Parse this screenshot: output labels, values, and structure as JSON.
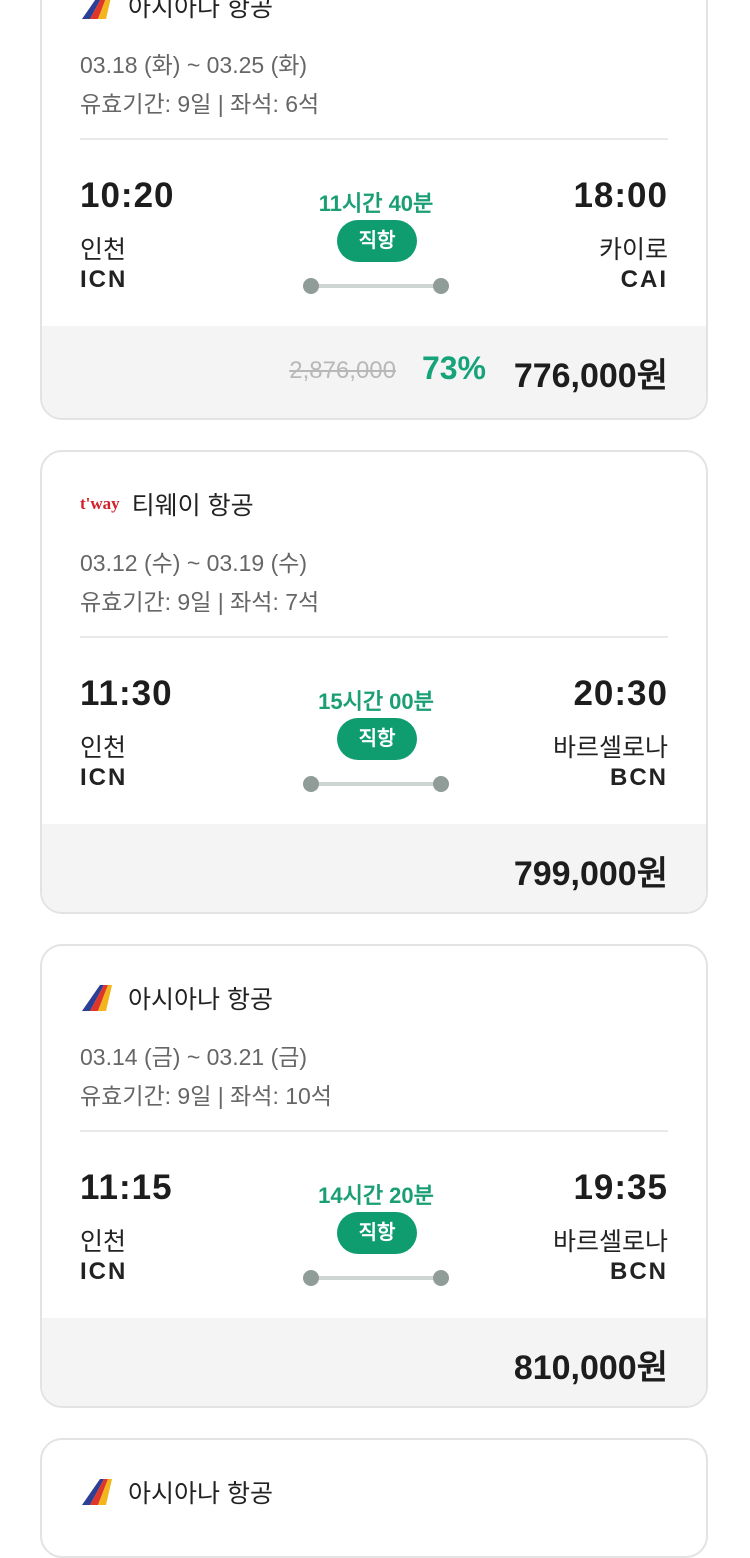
{
  "cards": [
    {
      "airline": "아시아나 항공",
      "airline_logo": "asiana-logo",
      "dates": "03.18 (화) ~ 03.25 (화)",
      "validity": "유효기간: 9일 | 좌석: 6석",
      "departure": {
        "time": "10:20",
        "city": "인천",
        "code": "ICN"
      },
      "arrival": {
        "time": "18:00",
        "city": "카이로",
        "code": "CAI"
      },
      "duration": "11시간 40분",
      "direct_label": "직항",
      "original_price": "2,876,000",
      "discount": "73%",
      "price": "776,000원"
    },
    {
      "airline": "티웨이 항공",
      "airline_logo": "tway-logo",
      "logo_text": "t'way",
      "dates": "03.12 (수) ~ 03.19 (수)",
      "validity": "유효기간: 9일 | 좌석: 7석",
      "departure": {
        "time": "11:30",
        "city": "인천",
        "code": "ICN"
      },
      "arrival": {
        "time": "20:30",
        "city": "바르셀로나",
        "code": "BCN"
      },
      "duration": "15시간 00분",
      "direct_label": "직항",
      "price": "799,000원"
    },
    {
      "airline": "아시아나 항공",
      "airline_logo": "asiana-logo",
      "dates": "03.14 (금) ~ 03.21 (금)",
      "validity": "유효기간: 9일 | 좌석: 10석",
      "departure": {
        "time": "11:15",
        "city": "인천",
        "code": "ICN"
      },
      "arrival": {
        "time": "19:35",
        "city": "바르셀로나",
        "code": "BCN"
      },
      "duration": "14시간 20분",
      "direct_label": "직항",
      "price": "810,000원"
    },
    {
      "airline": "아시아나 항공",
      "airline_logo": "asiana-logo"
    }
  ],
  "colors": {
    "accent": "#0f9d70",
    "duration_text": "#1a9e74",
    "price_bar_bg": "#f4f4f4",
    "card_border": "#e3e3e3"
  }
}
